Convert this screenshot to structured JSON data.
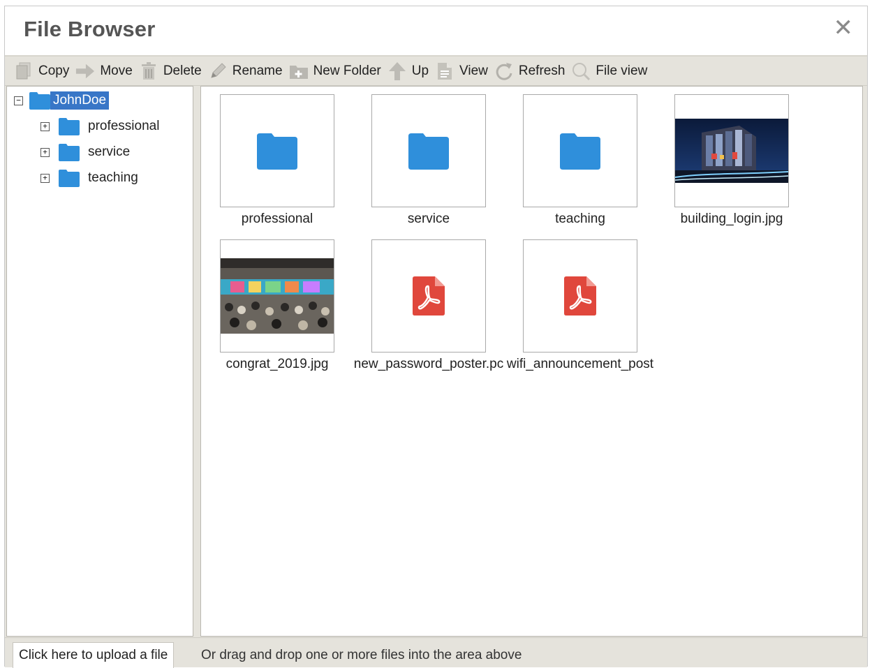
{
  "dialog": {
    "title": "File Browser",
    "close_glyph": "✕"
  },
  "toolbar": {
    "buttons": [
      {
        "label": "Copy",
        "icon": "copy-icon"
      },
      {
        "label": "Move",
        "icon": "arrow-right-icon"
      },
      {
        "label": "Delete",
        "icon": "trash-icon"
      },
      {
        "label": "Rename",
        "icon": "pencil-icon"
      },
      {
        "label": "New Folder",
        "icon": "new-folder-icon"
      },
      {
        "label": "Up",
        "icon": "arrow-up-icon"
      },
      {
        "label": "View",
        "icon": "document-icon"
      },
      {
        "label": "Refresh",
        "icon": "refresh-icon"
      },
      {
        "label": "File view",
        "icon": "magnifier-icon"
      }
    ]
  },
  "tree": {
    "root": {
      "label": "JohnDoe",
      "toggle": "−"
    },
    "children": [
      {
        "label": "professional",
        "toggle": "+"
      },
      {
        "label": "service",
        "toggle": "+"
      },
      {
        "label": "teaching",
        "toggle": "+"
      }
    ]
  },
  "files": [
    {
      "name": "professional",
      "kind": "folder"
    },
    {
      "name": "service",
      "kind": "folder"
    },
    {
      "name": "teaching",
      "kind": "folder"
    },
    {
      "name": "building_login.jpg",
      "kind": "image"
    },
    {
      "name": "congrat_2019.jpg",
      "kind": "image"
    },
    {
      "name": "new_password_poster.pc",
      "kind": "pdf"
    },
    {
      "name": "wifi_announcement_post",
      "kind": "pdf"
    }
  ],
  "footer": {
    "upload_label": "Click here to upload a file",
    "hint": "Or drag and drop one or more files into the area above"
  },
  "colors": {
    "folder": "#2f8fdb",
    "pdf": "#e0473c",
    "selection": "#3876c7",
    "chrome": "#e5e3dc"
  }
}
